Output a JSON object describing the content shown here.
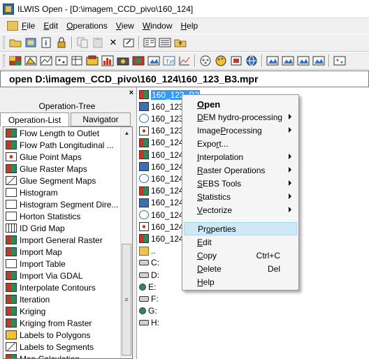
{
  "window": {
    "title": "ILWIS Open - [D:\\imagem_CCD_pivo\\160_124]"
  },
  "menubar": {
    "items": [
      {
        "label": "File",
        "u": "F",
        "rest": "ile"
      },
      {
        "label": "Edit",
        "u": "E",
        "rest": "dit"
      },
      {
        "label": "Operations",
        "u": "O",
        "rest": "perations"
      },
      {
        "label": "View",
        "u": "V",
        "rest": "iew"
      },
      {
        "label": "Window",
        "u": "W",
        "rest": "indow"
      },
      {
        "label": "Help",
        "u": "H",
        "rest": "elp"
      }
    ]
  },
  "command_line": {
    "value": "open D:\\imagem_CCD_pivo\\160_124\\160_123_B3.mpr"
  },
  "left_panel": {
    "close_label": "×",
    "tab_operation_tree": "Operation-Tree",
    "tab_operation_list": "Operation-List",
    "tab_navigator": "Navigator",
    "operations": [
      {
        "label": "Flow Length to Outlet",
        "icon": "raster-map-icon"
      },
      {
        "label": "Flow Path Longitudinal ...",
        "icon": "raster-map-icon"
      },
      {
        "label": "Glue Point Maps",
        "icon": "point-map-icon"
      },
      {
        "label": "Glue Raster Maps",
        "icon": "raster-map-icon"
      },
      {
        "label": "Glue Segment Maps",
        "icon": "segment-map-icon"
      },
      {
        "label": "Histogram",
        "icon": "table-icon"
      },
      {
        "label": "Histogram Segment Dire...",
        "icon": "table-icon"
      },
      {
        "label": "Horton Statistics",
        "icon": "table-icon"
      },
      {
        "label": "ID Grid Map",
        "icon": "grid-icon"
      },
      {
        "label": "Import General Raster",
        "icon": "raster-map-icon"
      },
      {
        "label": "Import Map",
        "icon": "raster-map-icon"
      },
      {
        "label": "Import Table",
        "icon": "table-icon"
      },
      {
        "label": "Import Via GDAL",
        "icon": "raster-map-icon"
      },
      {
        "label": "Interpolate Contours",
        "icon": "raster-map-icon"
      },
      {
        "label": "Iteration",
        "icon": "raster-map-icon"
      },
      {
        "label": "Kriging",
        "icon": "raster-map-icon"
      },
      {
        "label": "Kriging from Raster",
        "icon": "raster-map-icon"
      },
      {
        "label": "Labels to Polygons",
        "icon": "polygon-map-icon"
      },
      {
        "label": "Labels to Segments",
        "icon": "segment-map-icon"
      },
      {
        "label": "Map Calculation",
        "icon": "raster-map-icon"
      }
    ]
  },
  "file_list": {
    "items": [
      {
        "label": "160_123_B3",
        "icon": "raster-map-icon",
        "selected": true
      },
      {
        "label": "160_123",
        "icon": "map-list-icon"
      },
      {
        "label": "160_123",
        "icon": "georef-icon"
      },
      {
        "label": "160_123",
        "icon": "point-map-icon"
      },
      {
        "label": "160_124",
        "icon": "raster-map-icon"
      },
      {
        "label": "160_124",
        "icon": "raster-map-icon"
      },
      {
        "label": "160_124",
        "icon": "map-list-icon"
      },
      {
        "label": "160_124",
        "icon": "georef-icon"
      },
      {
        "label": "160_124",
        "icon": "raster-map-icon"
      },
      {
        "label": "160_124",
        "icon": "map-list-icon"
      },
      {
        "label": "160_124",
        "icon": "georef-icon"
      },
      {
        "label": "160_124",
        "icon": "point-map-icon"
      },
      {
        "label": "160_124",
        "icon": "raster-map-icon"
      },
      {
        "label": "..",
        "icon": "folder-icon"
      },
      {
        "label": "C:",
        "icon": "drive-icon"
      },
      {
        "label": "D:",
        "icon": "drive-icon"
      },
      {
        "label": "E:",
        "icon": "network-drive-icon"
      },
      {
        "label": "F:",
        "icon": "drive-icon"
      },
      {
        "label": "G:",
        "icon": "network-drive-icon"
      },
      {
        "label": "H:",
        "icon": "drive-icon"
      }
    ]
  },
  "context_menu": {
    "items": [
      {
        "label": "Open",
        "u": "O",
        "rest": "pen",
        "bold": true
      },
      {
        "label": "DEM hydro-processing",
        "u": "D",
        "rest": "EM hydro-processing",
        "submenu": true
      },
      {
        "label": "Image Processing",
        "pre": "Image ",
        "u": "P",
        "rest": "rocessing",
        "submenu": true
      },
      {
        "label": "Export...",
        "pre": "Expo",
        "u": "r",
        "rest": "t..."
      },
      {
        "label": "Interpolation",
        "u": "I",
        "rest": "nterpolation",
        "submenu": true
      },
      {
        "label": "Raster Operations",
        "u": "R",
        "rest": "aster Operations",
        "submenu": true
      },
      {
        "label": "SEBS Tools",
        "u": "S",
        "rest": "EBS Tools",
        "submenu": true
      },
      {
        "label": "Statistics",
        "u": "S",
        "rest": "tatistics",
        "submenu": true
      },
      {
        "label": "Vectorize",
        "u": "V",
        "rest": "ectorize",
        "submenu": true
      },
      {
        "label": "Properties",
        "pre": "Pr",
        "u": "o",
        "rest": "perties",
        "highlighted": true
      },
      {
        "label": "Edit",
        "u": "E",
        "rest": "dit"
      },
      {
        "label": "Copy",
        "u": "C",
        "rest": "opy",
        "shortcut": "Ctrl+C"
      },
      {
        "label": "Delete",
        "u": "D",
        "rest": "elete",
        "shortcut": "Del"
      },
      {
        "label": "Help",
        "u": "H",
        "rest": "elp"
      }
    ]
  },
  "colors": {
    "selection": "#3399ff",
    "menu_highlight": "#cfe8f6",
    "raster_icon": "#c0392b",
    "map_list_icon": "#3b6fb6",
    "folder_icon": "#e8c25a"
  }
}
